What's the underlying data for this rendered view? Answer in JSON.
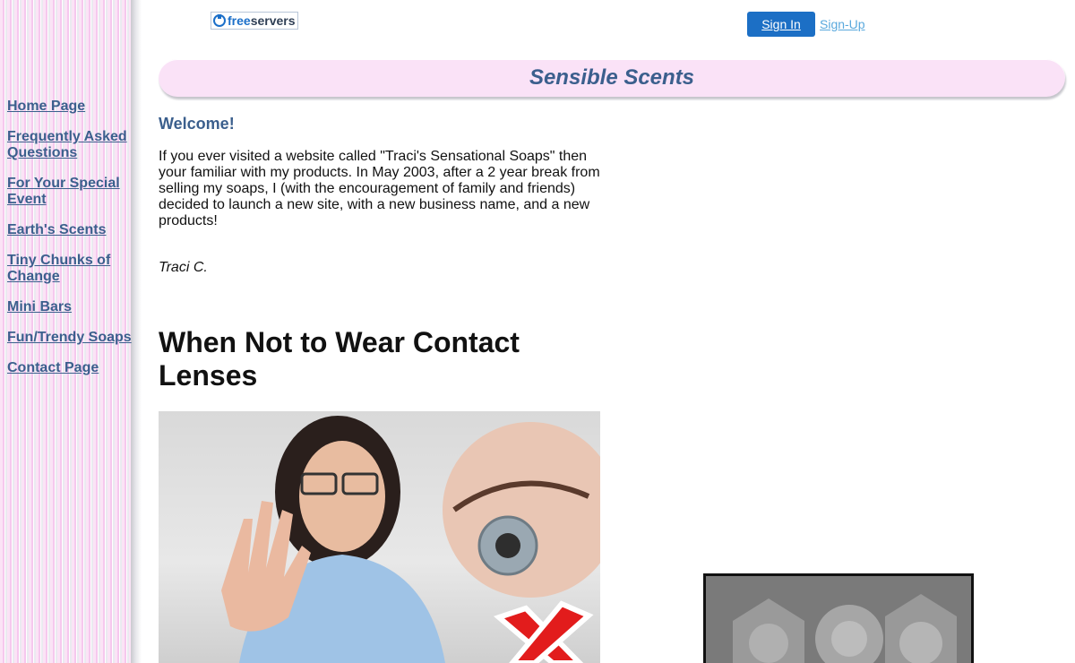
{
  "header": {
    "logo_text_free": "free",
    "logo_text_servers": "servers",
    "signin_label": "Sign In",
    "signup_label": "Sign-Up"
  },
  "sidebar": {
    "items": [
      {
        "label": "Home Page"
      },
      {
        "label": "Frequently Asked Questions"
      },
      {
        "label": "For Your Special Event"
      },
      {
        "label": "Earth's Scents"
      },
      {
        "label": "Tiny Chunks of Change"
      },
      {
        "label": "Mini Bars"
      },
      {
        "label": "Fun/Trendy Soaps"
      },
      {
        "label": "Contact Page"
      }
    ]
  },
  "banner": {
    "title": "Sensible Scents"
  },
  "main": {
    "welcome_heading": "Welcome!",
    "intro_text": "If you ever visited a website called \"Traci's Sensational Soaps\" then your familiar with my products. In May 2003, after a 2 year break from selling my soaps, I (with the encouragement of family and friends) decided to launch a new site, with a new business name, and a new products!",
    "signature": "Traci C.",
    "article_title": "When Not to Wear Contact Lenses"
  },
  "colors": {
    "link": "#3b5f8d",
    "banner_bg": "#fae2f7",
    "signin_bg": "#1c6fc5",
    "signup_link": "#5aa9dd"
  }
}
